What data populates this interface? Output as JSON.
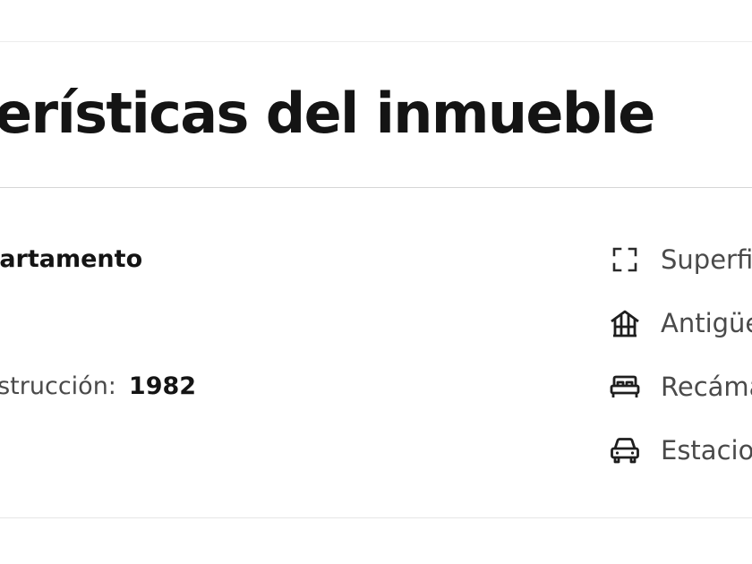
{
  "section": {
    "title": "terísticas del inmueble"
  },
  "details": {
    "type_value": "partamento",
    "year_label": "nstrucción:",
    "year_value": "1982"
  },
  "features": [
    {
      "icon": "expand-frame-icon",
      "label": "Superfi"
    },
    {
      "icon": "house-icon",
      "label": "Antigüe"
    },
    {
      "icon": "bed-icon",
      "label": "Recáma"
    },
    {
      "icon": "car-icon",
      "label": "Estacio"
    }
  ]
}
